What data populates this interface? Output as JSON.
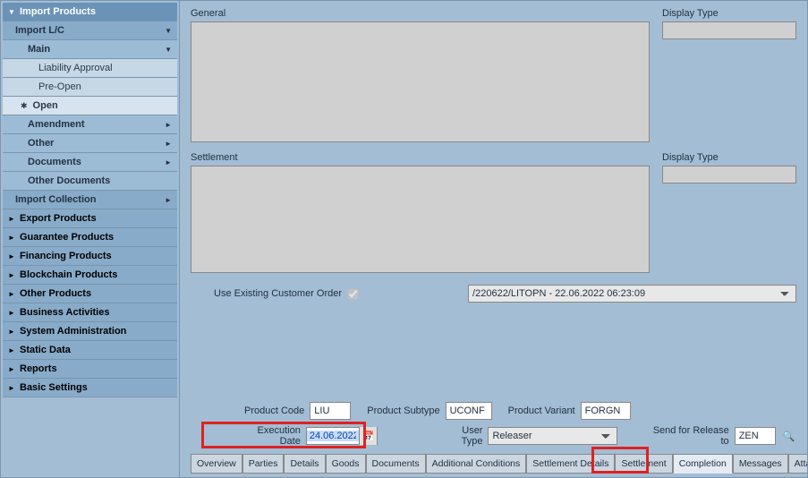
{
  "sidebar": {
    "importProducts": "Import Products",
    "importLC": "Import L/C",
    "main": "Main",
    "liabilityApproval": "Liability Approval",
    "preOpen": "Pre-Open",
    "open": "Open",
    "amendment": "Amendment",
    "other": "Other",
    "documents": "Documents",
    "otherDocuments": "Other Documents",
    "importCollection": "Import Collection",
    "exportProducts": "Export Products",
    "guaranteeProducts": "Guarantee Products",
    "financingProducts": "Financing Products",
    "blockchainProducts": "Blockchain Products",
    "otherProducts": "Other Products",
    "businessActivities": "Business Activities",
    "systemAdministration": "System Administration",
    "staticData": "Static Data",
    "reports": "Reports",
    "basicSettings": "Basic Settings"
  },
  "panels": {
    "general": "General",
    "settlement": "Settlement",
    "displayType": "Display Type"
  },
  "order": {
    "label": "Use Existing Customer Order",
    "selected": "/220622/LITOPN - 22.06.2022 06:23:09"
  },
  "fields": {
    "productCodeLabel": "Product Code",
    "productCode": "LIU",
    "productSubtypeLabel": "Product Subtype",
    "productSubtype": "UCONF",
    "productVariantLabel": "Product Variant",
    "productVariant": "FORGN",
    "executionDateLabel": "Execution Date",
    "executionDate": "24.06.2022",
    "userTypeLabel": "User Type",
    "userType": "Releaser",
    "sendForReleaseLabel": "Send for Release to",
    "sendForRelease": "ZEN"
  },
  "tabs": {
    "overview": "Overview",
    "parties": "Parties",
    "details": "Details",
    "goods": "Goods",
    "documents": "Documents",
    "additionalConditions": "Additional Conditions",
    "settlementDetails": "Settlement Details",
    "settlement": "Settlement",
    "completion": "Completion",
    "messages": "Messages",
    "attachments": "Attachments"
  }
}
